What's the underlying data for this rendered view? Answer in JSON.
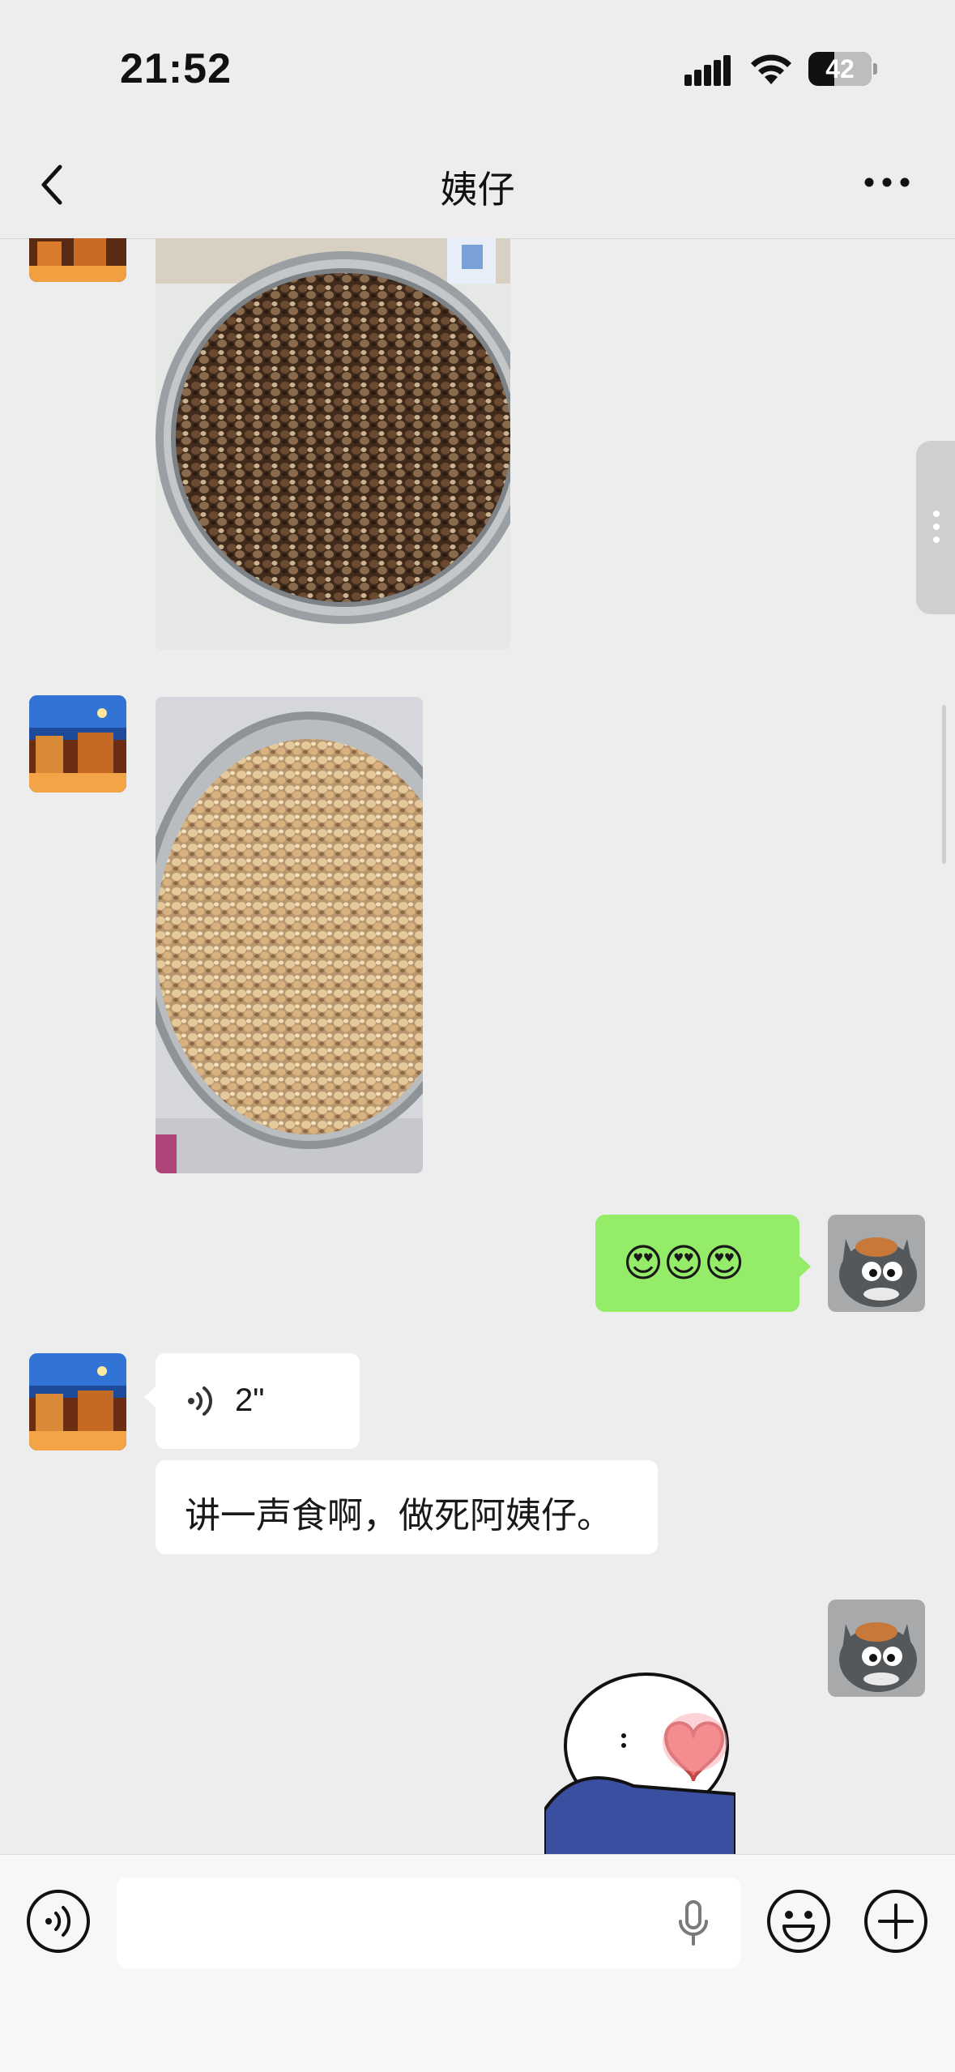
{
  "status_bar": {
    "time": "21:52",
    "battery": "42"
  },
  "nav": {
    "title": "姨仔"
  },
  "messages": [
    {
      "type": "image",
      "from": "contact",
      "description": "roasted peanuts in steel pan"
    },
    {
      "type": "image",
      "from": "contact",
      "description": "shelled peanuts in steel pan"
    },
    {
      "type": "text",
      "from": "me",
      "text": "😍😍😍"
    },
    {
      "type": "voice",
      "from": "contact",
      "duration": "2\""
    },
    {
      "type": "text",
      "from": "contact",
      "text": "讲一声食啊，做死阿姨仔。"
    },
    {
      "type": "sticker",
      "from": "me"
    }
  ],
  "colors": {
    "background": "#ededed",
    "outgoing_bubble": "#95ec69",
    "incoming_bubble": "#ffffff"
  }
}
